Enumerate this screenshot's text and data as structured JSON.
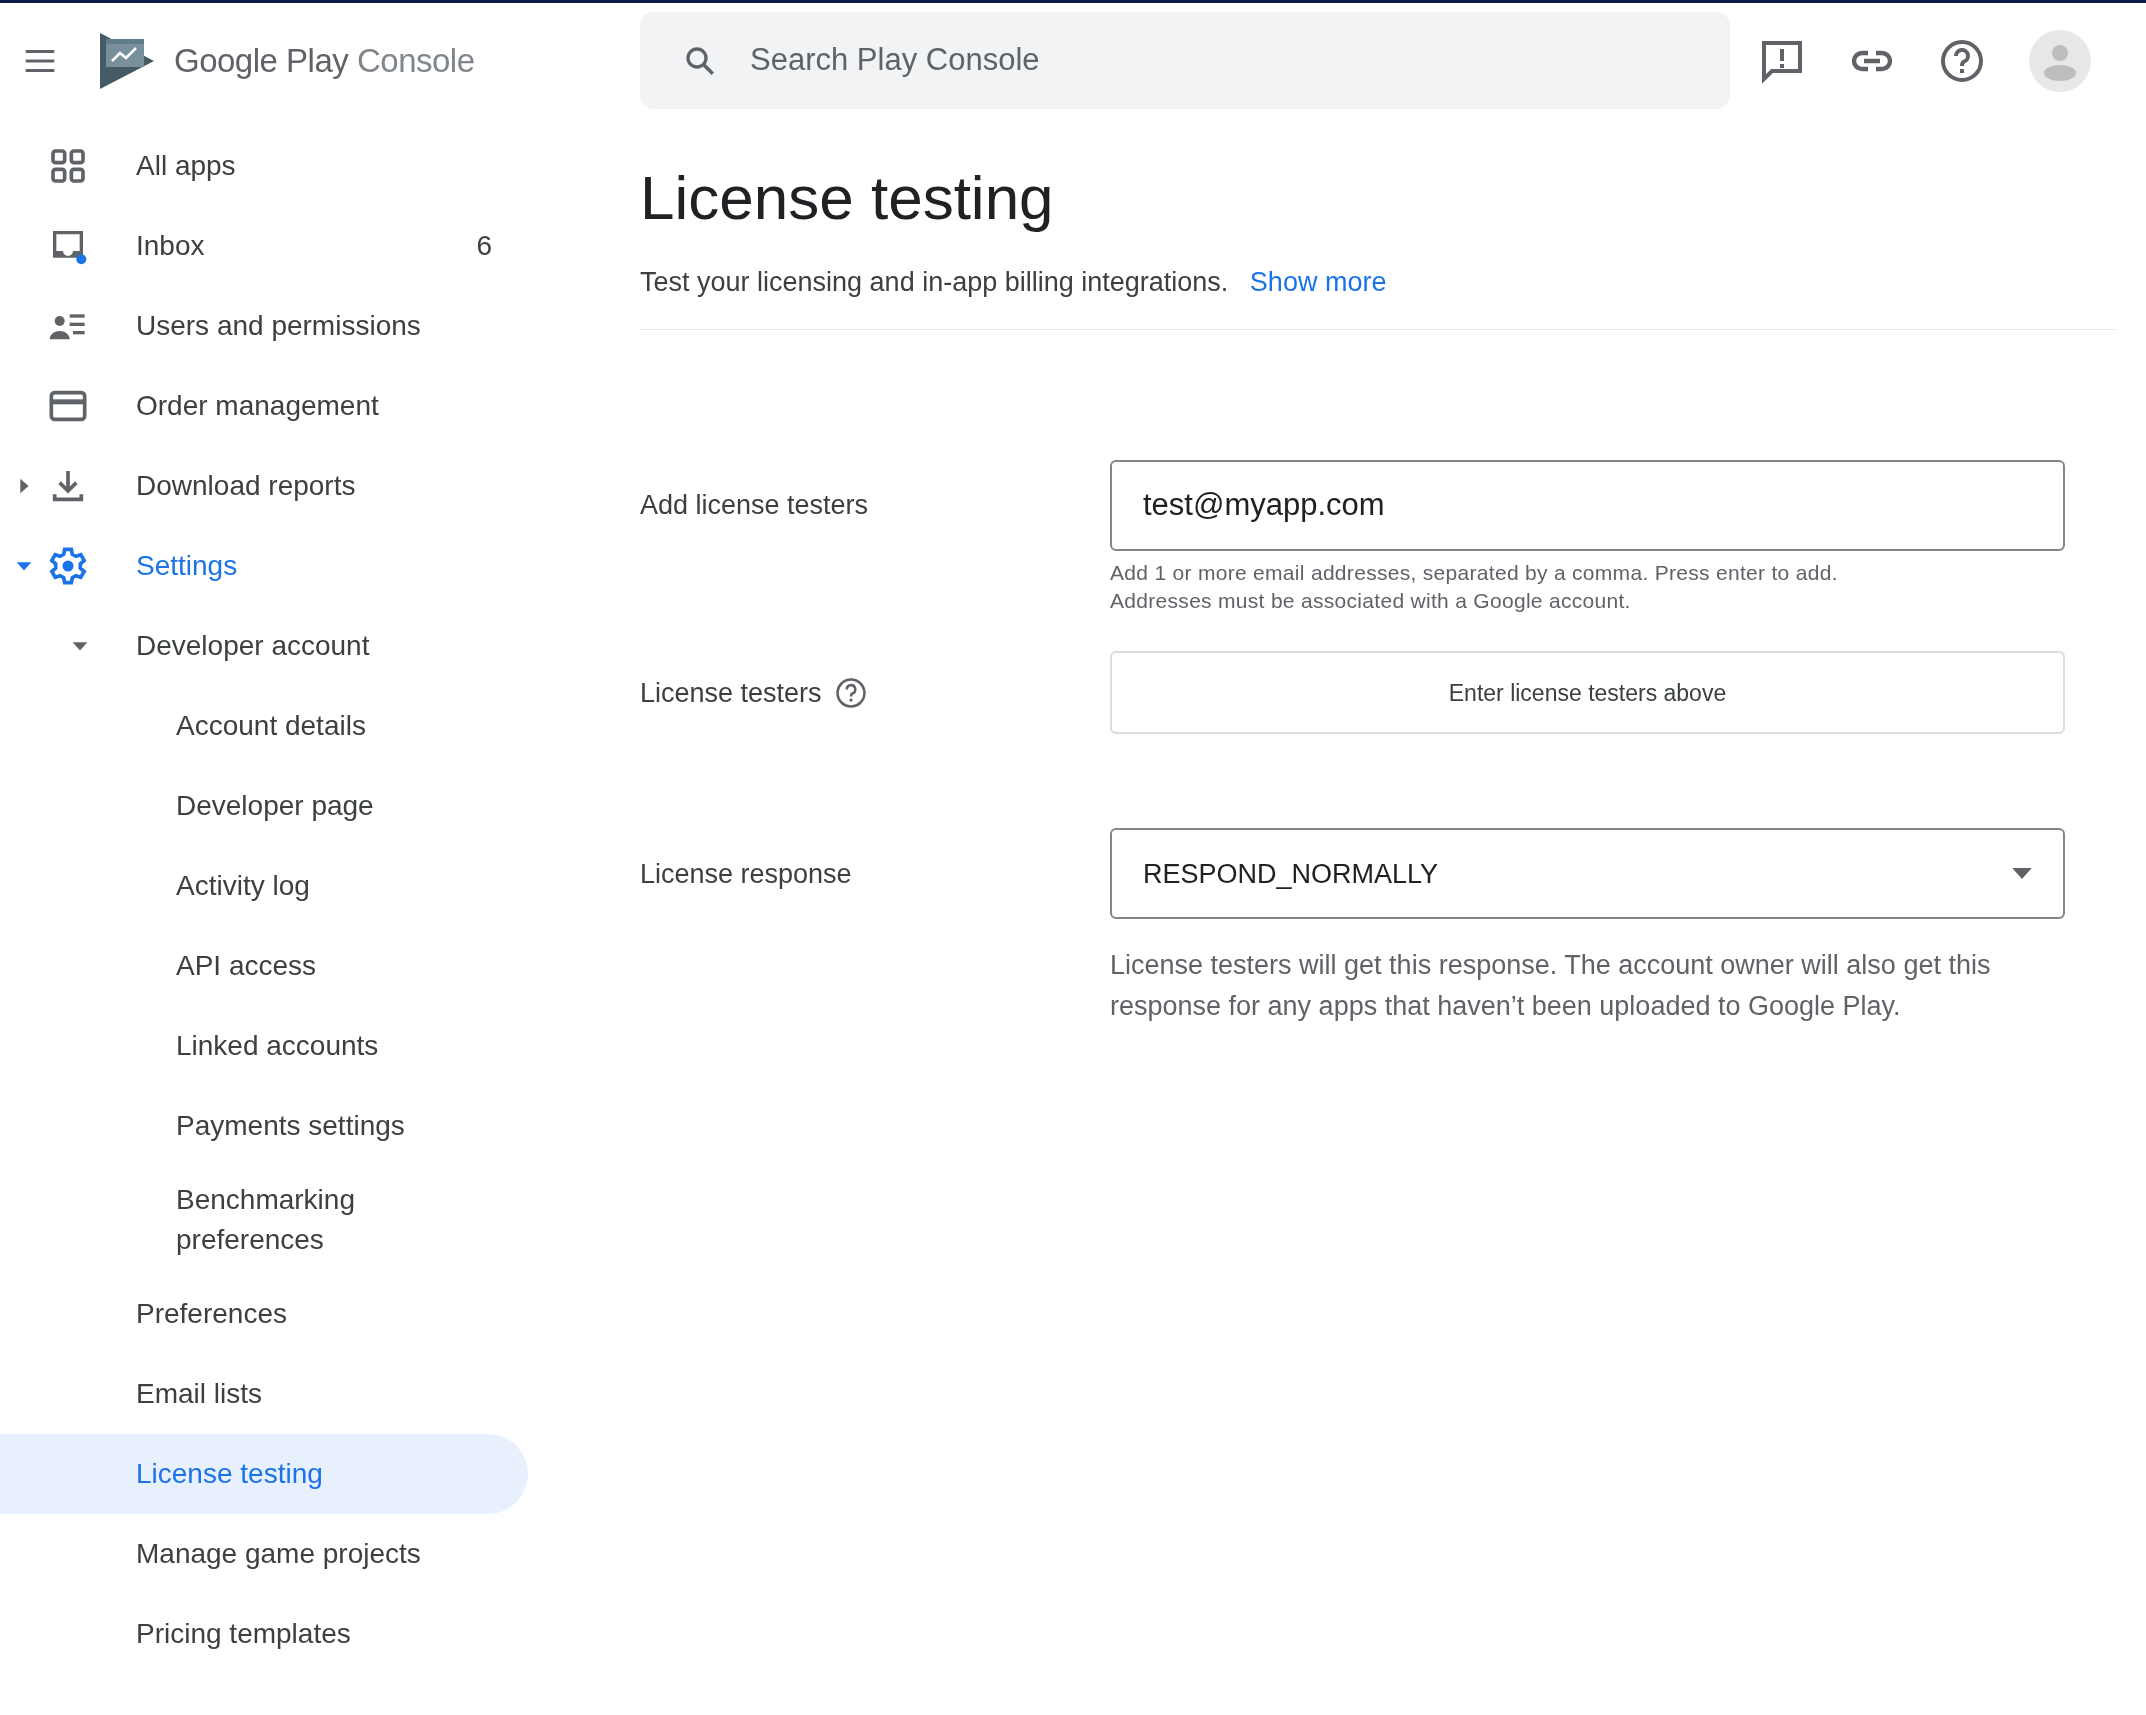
{
  "header": {
    "logo_text": "Google Play",
    "logo_suffix": "Console",
    "search": {
      "placeholder": "Search Play Console"
    }
  },
  "sidebar": {
    "items": [
      {
        "label": "All apps",
        "selected": false
      },
      {
        "label": "Inbox",
        "selected": false,
        "count": "6",
        "unread": true
      },
      {
        "label": "Users and permissions",
        "selected": false
      },
      {
        "label": "Order management",
        "selected": false
      },
      {
        "label": "Download reports",
        "selected": false,
        "expanded": false
      },
      {
        "label": "Settings",
        "selected": false,
        "expanded": true,
        "children": [
          {
            "label": "Developer account",
            "selected": false,
            "expanded": true,
            "children": [
              {
                "label": "Account details",
                "selected": false
              },
              {
                "label": "Developer page",
                "selected": false
              },
              {
                "label": "Activity log",
                "selected": false
              },
              {
                "label": "API access",
                "selected": false
              },
              {
                "label": "Linked accounts",
                "selected": false
              },
              {
                "label": "Payments settings",
                "selected": false
              },
              {
                "label": "Benchmarking preferences",
                "selected": false
              }
            ]
          },
          {
            "label": "Preferences",
            "selected": false
          },
          {
            "label": "Email lists",
            "selected": false
          },
          {
            "label": "License testing",
            "selected": true
          },
          {
            "label": "Manage game projects",
            "selected": false
          },
          {
            "label": "Pricing templates",
            "selected": false
          }
        ]
      }
    ]
  },
  "page": {
    "title": "License testing",
    "subtitle": "Test your licensing and in-app billing integrations.",
    "show_more": "Show more",
    "add_testers": {
      "label": "Add license testers",
      "value": "test@myapp.com",
      "helper": "Add 1 or more email addresses, separated by a comma. Press enter to add.\nAddresses must be associated with a Google account."
    },
    "testers": {
      "label": "License testers",
      "empty_text": "Enter license testers above"
    },
    "response": {
      "label": "License response",
      "value": "RESPOND_NORMALLY",
      "helper": "License testers will get this response. The account owner will also get this response for any apps that haven’t been uploaded to Google Play."
    }
  }
}
